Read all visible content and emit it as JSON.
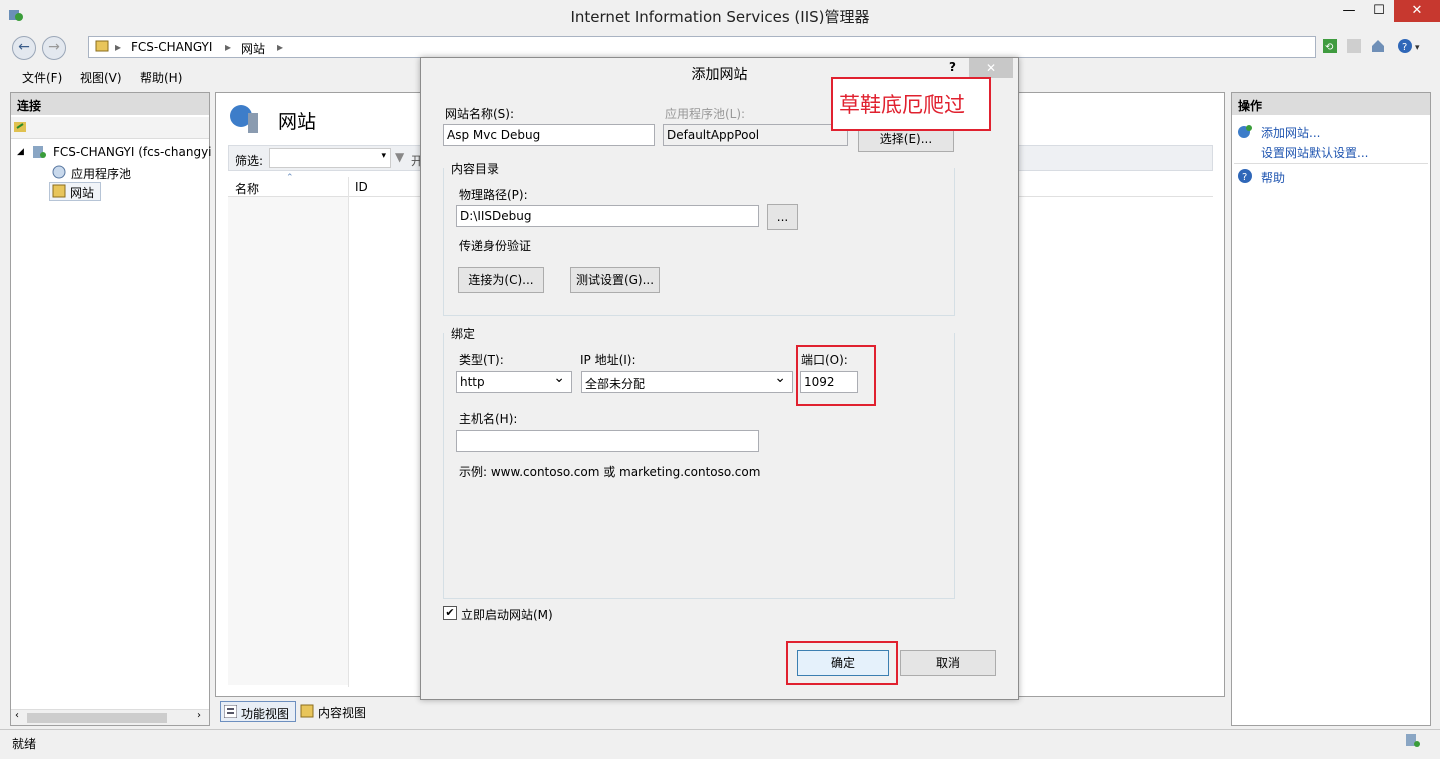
{
  "window": {
    "title": "Internet Information Services (IIS)管理器"
  },
  "breadcrumb": [
    "FCS-CHANGYI",
    "网站"
  ],
  "menu": [
    "文件(F)",
    "视图(V)",
    "帮助(H)"
  ],
  "left_panel": {
    "header": "连接",
    "tree": {
      "root": "FCS-CHANGYI (fcs-changyi",
      "children": [
        "应用程序池",
        "网站"
      ]
    }
  },
  "center": {
    "title": "网站",
    "filter_label": "筛选:",
    "filter_go": "开",
    "columns": [
      "名称",
      "ID"
    ],
    "view_tabs": [
      "功能视图",
      "内容视图"
    ]
  },
  "right_panel": {
    "header": "操作",
    "actions": [
      "添加网站...",
      "设置网站默认设置...",
      "帮助"
    ]
  },
  "status": {
    "text": "就绪"
  },
  "dialog": {
    "title": "添加网站",
    "help": "?",
    "site_name_label": "网站名称(S):",
    "site_name_value": "Asp Mvc Debug",
    "app_pool_label": "应用程序池(L):",
    "app_pool_value": "DefaultAppPool",
    "select_button": "选择(E)...",
    "annotation": "草鞋底厄爬过",
    "content_dir": {
      "legend": "内容目录",
      "path_label": "物理路径(P):",
      "path_value": "D:\\IISDebug",
      "browse": "...",
      "auth_label": "传递身份验证",
      "connect_as": "连接为(C)...",
      "test_settings": "测试设置(G)..."
    },
    "binding": {
      "legend": "绑定",
      "type_label": "类型(T):",
      "type_value": "http",
      "ip_label": "IP 地址(I):",
      "ip_value": "全部未分配",
      "port_label": "端口(O):",
      "port_value": "1092",
      "host_label": "主机名(H):",
      "host_value": "",
      "example": "示例: www.contoso.com 或 marketing.contoso.com"
    },
    "start_now": "立即启动网站(M)",
    "ok": "确定",
    "cancel": "取消"
  },
  "colors": {
    "accent_red": "#e0212f",
    "link_blue": "#1f55b0",
    "close_red": "#c7382f"
  }
}
